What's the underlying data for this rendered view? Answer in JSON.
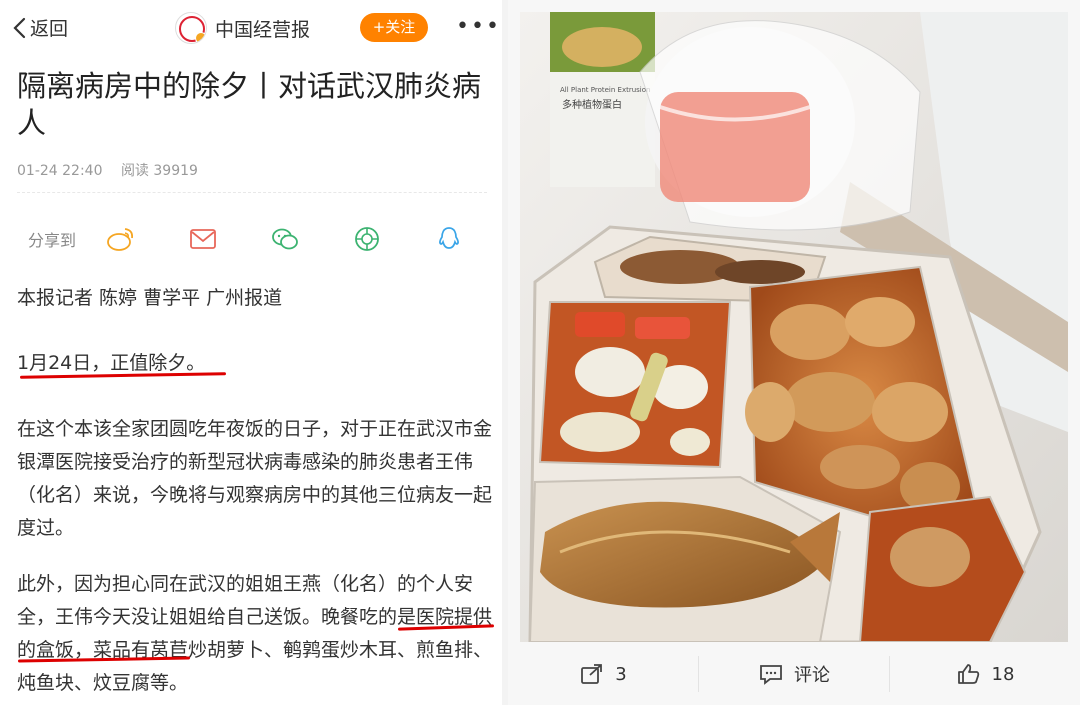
{
  "header": {
    "back_label": "返回",
    "brand_name": "中国经营报",
    "follow_label": "+关注",
    "more_label": "•••"
  },
  "article": {
    "title": "隔离病房中的除夕丨对话武汉肺炎病人",
    "time": "01-24 22:40",
    "reads": "阅读 39919",
    "share_label": "分享到",
    "share_icons": [
      "weibo-icon",
      "email-icon",
      "wechat-icon",
      "moments-icon",
      "qq-icon"
    ],
    "byline": "本报记者 陈婷 曹学平 广州报道",
    "date_line": "1月24日，正值除夕。",
    "para1": "在这个本该全家团圆吃年夜饭的日子，对于正在武汉市金银潭医院接受治疗的新型冠状病毒感染的肺炎患者王伟（化名）来说，今晚将与观察病房中的其他三位病友一起度过。",
    "para2": "此外，因为担心同在武汉的姐姐王燕（化名）的个人安全，王伟今天没让姐姐给自己送饭。晚餐吃的是医院提供的盒饭，菜品有莴苣炒胡萝卜、鹌鹑蛋炒木耳、煎鱼排、炖鱼块、炆豆腐等。"
  },
  "photo": {
    "package_text": "All Plant Protein Extrusion",
    "package_text_cn": "多种植物蛋白"
  },
  "actions": {
    "repost_count": "3",
    "comment_label": "评论",
    "like_count": "18"
  },
  "colors": {
    "accent": "#ff8200",
    "underline": "#dd0000"
  }
}
